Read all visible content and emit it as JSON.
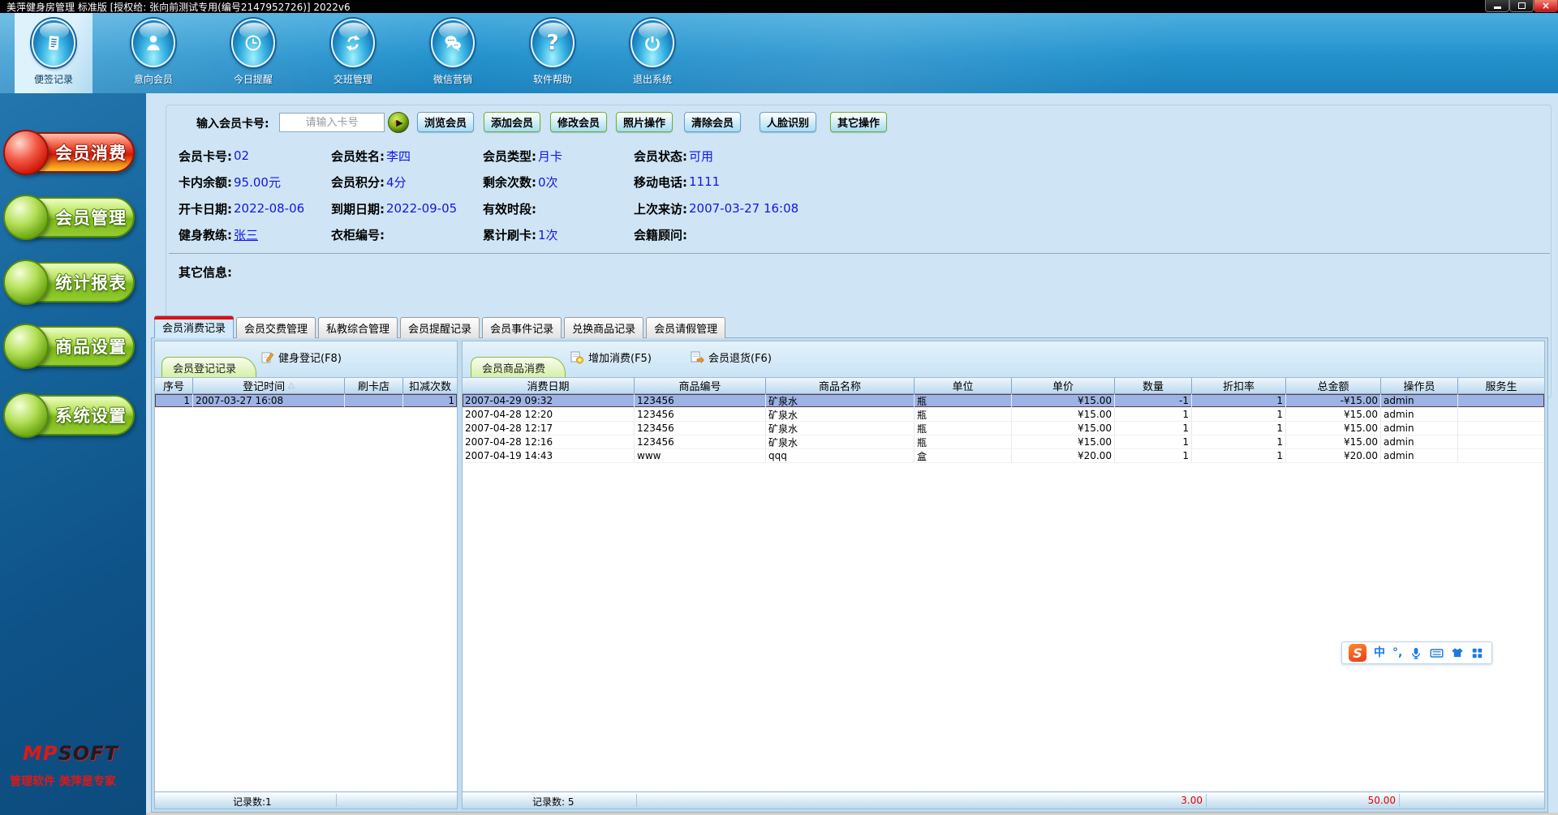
{
  "window": {
    "title": "美萍健身房管理 标准版 [授权给: 张向前测试专用(编号2147952726)]  2022v6",
    "close_glyph": "×"
  },
  "toolbar": {
    "items": [
      {
        "label": "便签记录",
        "icon": "note-icon"
      },
      {
        "label": "意向会员",
        "icon": "person-icon"
      },
      {
        "label": "今日提醒",
        "icon": "clock-icon"
      },
      {
        "label": "交班管理",
        "icon": "shift-refresh-icon"
      },
      {
        "label": "微信营销",
        "icon": "wechat-chat-icon"
      },
      {
        "label": "软件帮助",
        "icon": "question-icon",
        "glyph": "?"
      },
      {
        "label": "退出系统",
        "icon": "power-icon"
      }
    ]
  },
  "sidebar": {
    "items": [
      {
        "label": "会员消费"
      },
      {
        "label": "会员管理"
      },
      {
        "label": "统计报表"
      },
      {
        "label": "商品设置"
      },
      {
        "label": "系统设置"
      }
    ],
    "logo_mp": "MP",
    "logo_soft": "SOFT",
    "slogan": "管理软件 美萍是专家"
  },
  "lookup": {
    "label": "输入会员卡号:",
    "placeholder": "请输入卡号",
    "go_glyph": "▶",
    "buttons": [
      "浏览会员",
      "添加会员",
      "修改会员",
      "照片操作",
      "清除会员",
      "人脸识别",
      "其它操作"
    ]
  },
  "info": {
    "fields": [
      {
        "label": "会员卡号:",
        "value": "02"
      },
      {
        "label": "会员姓名:",
        "value": "李四"
      },
      {
        "label": "会员类型:",
        "value": "月卡"
      },
      {
        "label": "会员状态:",
        "value": "可用"
      },
      {
        "label": "卡内余额:",
        "value": "95.00元"
      },
      {
        "label": "会员积分:",
        "value": "4分"
      },
      {
        "label": "剩余次数:",
        "value": "0次"
      },
      {
        "label": "移动电话:",
        "value": "1111"
      },
      {
        "label": "开卡日期:",
        "value": "2022-08-06"
      },
      {
        "label": "到期日期:",
        "value": "2022-09-05"
      },
      {
        "label": "有效时段:",
        "value": ""
      },
      {
        "label": "上次来访:",
        "value": "2007-03-27 16:08"
      },
      {
        "label": "健身教练:",
        "value": "张三"
      },
      {
        "label": "衣柜编号:",
        "value": ""
      },
      {
        "label": "累计刷卡:",
        "value": "1次"
      },
      {
        "label": "会籍顾问:",
        "value": ""
      }
    ],
    "other_label": "其它信息:"
  },
  "tabs": [
    "会员消费记录",
    "会员交费管理",
    "私教综合管理",
    "会员提醒记录",
    "会员事件记录",
    "兑换商品记录",
    "会员请假管理"
  ],
  "left_panel": {
    "tab": "会员登记记录",
    "action": "健身登记(F8)",
    "headers": [
      "序号",
      "登记时间",
      "刷卡店",
      "扣减次数"
    ],
    "sort_glyph": "△",
    "rows": [
      [
        "1",
        "2007-03-27 16:08",
        "",
        "1"
      ]
    ],
    "status": "记录数:1"
  },
  "right_panel": {
    "tab": "会员商品消费",
    "action_add": "增加消费(F5)",
    "action_return": "会员退货(F6)",
    "headers": [
      "消费日期",
      "商品编号",
      "商品名称",
      "单位",
      "单价",
      "数量",
      "折扣率",
      "总金额",
      "操作员",
      "服务生"
    ],
    "rows": [
      [
        "2007-04-29 09:32",
        "123456",
        "矿泉水",
        "瓶",
        "¥15.00",
        "-1",
        "1",
        "-¥15.00",
        "admin",
        ""
      ],
      [
        "2007-04-28 12:20",
        "123456",
        "矿泉水",
        "瓶",
        "¥15.00",
        "1",
        "1",
        "¥15.00",
        "admin",
        ""
      ],
      [
        "2007-04-28 12:17",
        "123456",
        "矿泉水",
        "瓶",
        "¥15.00",
        "1",
        "1",
        "¥15.00",
        "admin",
        ""
      ],
      [
        "2007-04-28 12:16",
        "123456",
        "矿泉水",
        "瓶",
        "¥15.00",
        "1",
        "1",
        "¥15.00",
        "admin",
        ""
      ],
      [
        "2007-04-19 14:43",
        "www",
        "qqq",
        "盒",
        "¥20.00",
        "1",
        "1",
        "¥20.00",
        "admin",
        ""
      ]
    ],
    "status": "记录数: 5",
    "sum_quantity": "3.00",
    "sum_amount": "50.00"
  },
  "ime": {
    "logo": "S",
    "mode": "中",
    "punct": "°,"
  },
  "colors": {
    "toolbar_blue": "#1b82bd",
    "value_blue": "#1414e6",
    "alert_red": "#e00000",
    "tab_red": "#e01010",
    "pill_green": "#7ab818",
    "pill_red": "#d41808"
  }
}
